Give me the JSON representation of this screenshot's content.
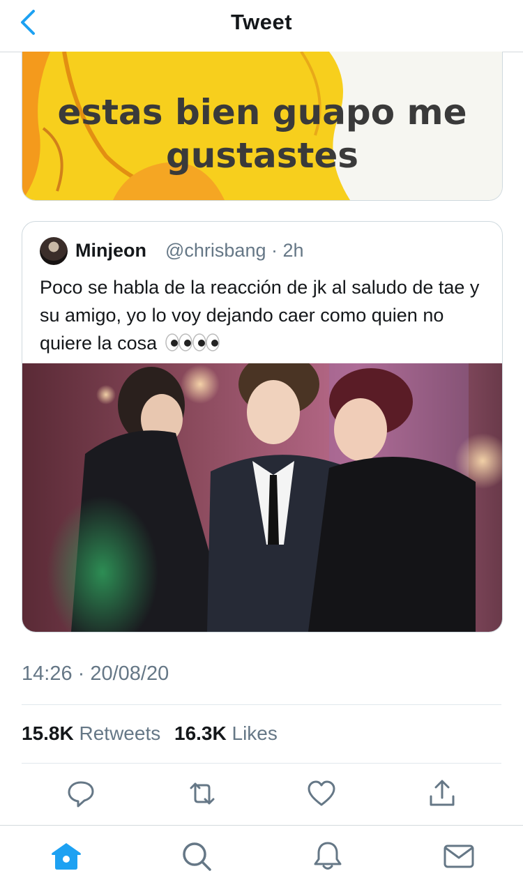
{
  "header": {
    "title": "Tweet",
    "back_icon": "chevron-left-icon"
  },
  "meme": {
    "line1": "estas bien guapo me",
    "line2": "gustastes"
  },
  "quoted_tweet": {
    "name": "Minjeon",
    "handle": "@chrisbang",
    "time": "2h",
    "text": "Poco se habla de la reacción de jk al saludo de tae y su amigo, yo lo voy dejando caer como quien no quiere la cosa",
    "emoji": "eyes-emoji-x2"
  },
  "tweet": {
    "timestamp": "14:26 · 20/08/20",
    "retweets_count": "15.8K",
    "retweets_label": "Retweets",
    "likes_count": "16.3K",
    "likes_label": "Likes"
  },
  "actions": [
    "reply-icon",
    "retweet-icon",
    "like-icon",
    "share-icon"
  ],
  "tabs": [
    "home-icon",
    "search-icon",
    "notifications-icon",
    "messages-icon"
  ],
  "colors": {
    "accent": "#1da1f2",
    "secondary_text": "#657786",
    "border": "#e1e8ed"
  }
}
